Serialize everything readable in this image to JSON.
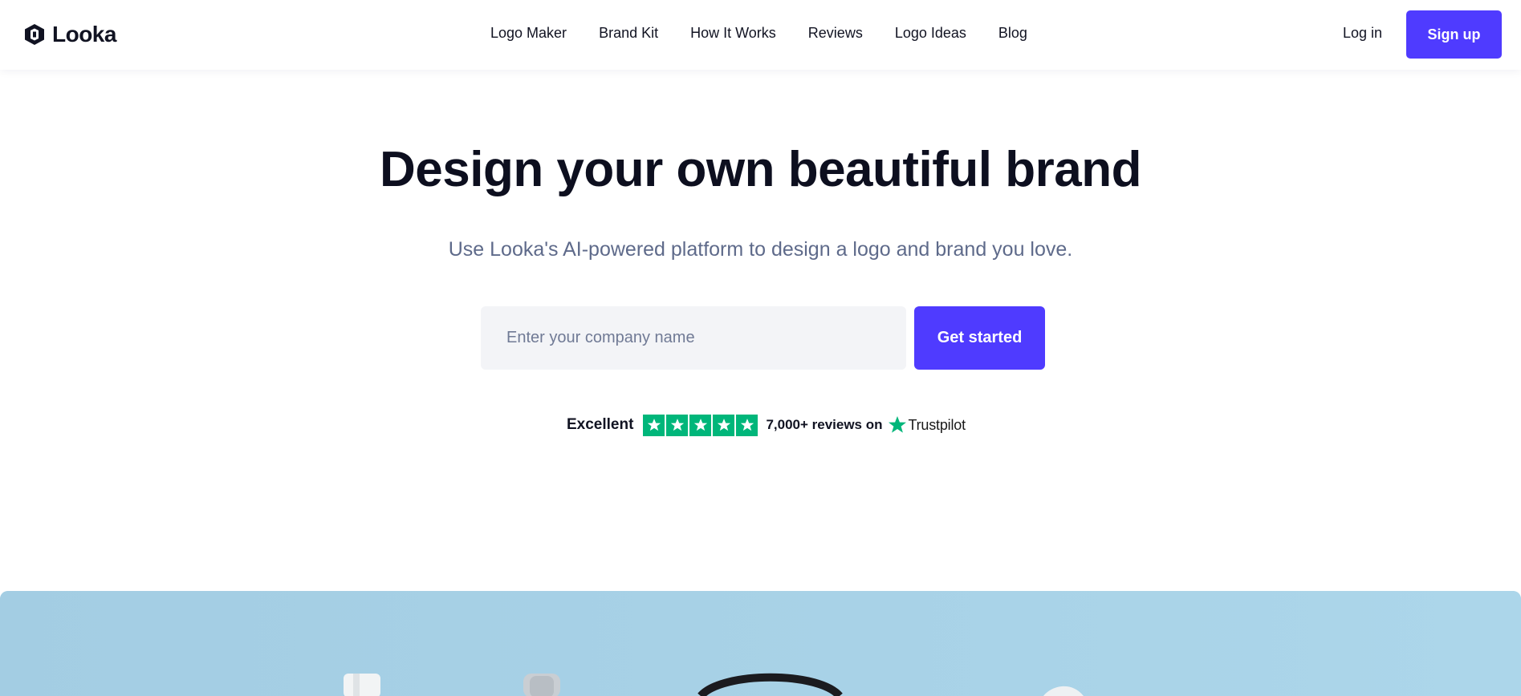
{
  "header": {
    "brand_name": "Looka",
    "nav": [
      {
        "label": "Logo Maker"
      },
      {
        "label": "Brand Kit"
      },
      {
        "label": "How It Works"
      },
      {
        "label": "Reviews"
      },
      {
        "label": "Logo Ideas"
      },
      {
        "label": "Blog"
      }
    ],
    "login_label": "Log in",
    "signup_label": "Sign up"
  },
  "hero": {
    "title": "Design your own beautiful brand",
    "subtitle": "Use Looka's AI-powered platform to design a logo and brand you love.",
    "input_placeholder": "Enter your company name",
    "input_value": "",
    "cta_label": "Get started"
  },
  "trust": {
    "rating_label": "Excellent",
    "stars": 5,
    "reviews_label": "7,000+ reviews on",
    "provider": "Trustpilot"
  },
  "colors": {
    "accent": "#4f3bff",
    "trustpilot_green": "#00b67a",
    "subtitle": "#5e6a8a",
    "input_bg": "#f3f4f7",
    "image_bg": "#a7d1e6"
  },
  "icons": {
    "brand": "looka-logo-icon",
    "star": "star-icon",
    "trustpilot": "trustpilot-star-icon"
  }
}
